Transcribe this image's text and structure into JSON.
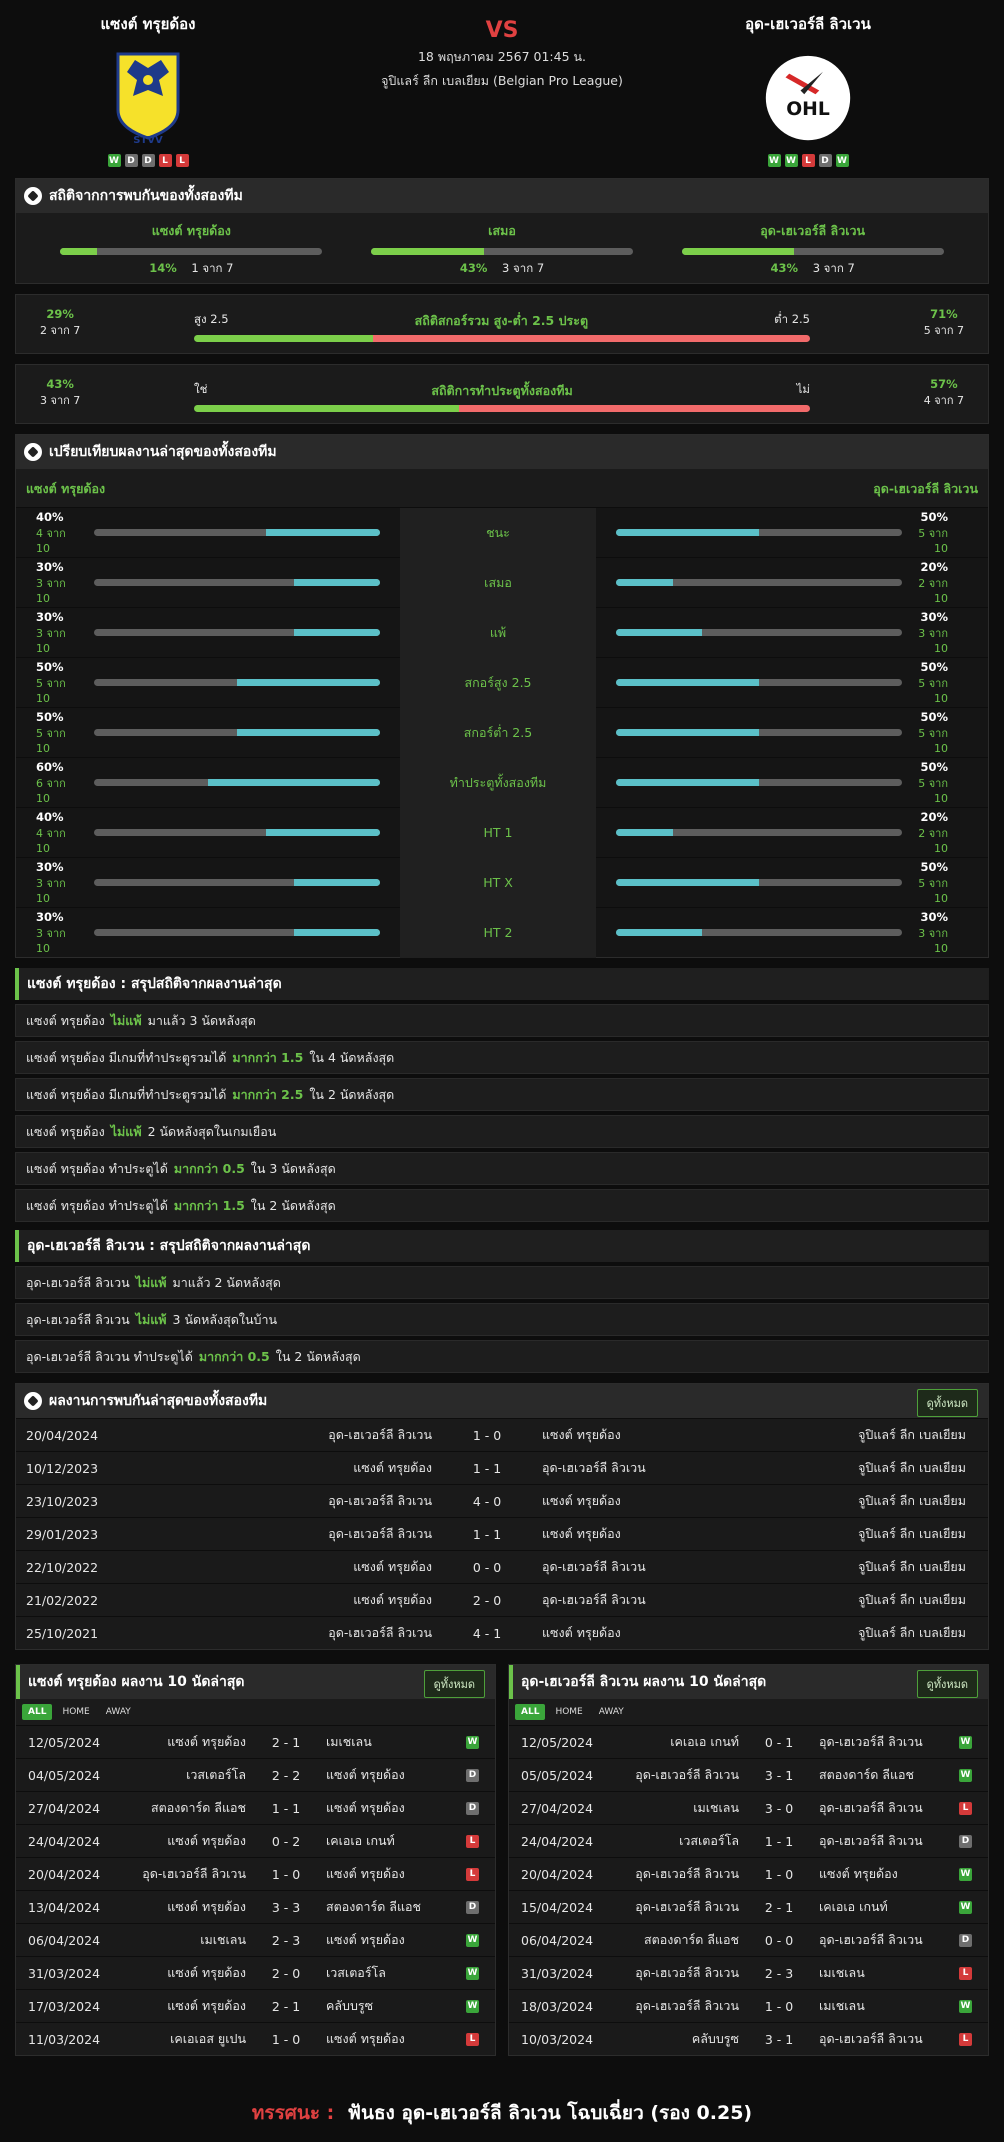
{
  "home": {
    "name": "แซงต์ ทรุยด้อง",
    "form": [
      "W",
      "D",
      "D",
      "L",
      "L"
    ]
  },
  "away": {
    "name": "อุด-เฮเวอร์ลี ลิวเวน",
    "form": [
      "W",
      "W",
      "L",
      "D",
      "W"
    ]
  },
  "match": {
    "vs": "VS",
    "date": "18 พฤษภาคม 2567 01:45 น.",
    "league": "จูปิแลร์ ลีก เบลเยียม (Belgian Pro League)"
  },
  "sections": {
    "h2h_stats": "สถิติจากการพบกันของทั้งสองทีม",
    "compare": "เปรียบเทียบผลงานล่าสุดของทั้งสองทีม",
    "h2h_results": "ผลงานการพบกันล่าสุดของทั้งสองทีม",
    "view_all": "ดูทั้งหมด"
  },
  "h2h_summary": [
    {
      "title": "แซงต์ ทรุยด้อง",
      "pct": "14%",
      "count": "1 จาก 7",
      "fill": 14
    },
    {
      "title": "เสมอ",
      "pct": "43%",
      "count": "3 จาก 7",
      "fill": 43
    },
    {
      "title": "อุด-เฮเวอร์ลี ลิวเวน",
      "pct": "43%",
      "count": "3 จาก 7",
      "fill": 43
    }
  ],
  "over_under": {
    "title": "สถิติสกอร์รวม สูง-ต่ำ 2.5 ประตู",
    "left_label": "สูง 2.5",
    "right_label": "ต่ำ 2.5",
    "left_pct": "29%",
    "left_count": "2 จาก 7",
    "right_pct": "71%",
    "right_count": "5 จาก 7",
    "fill": 29
  },
  "btts": {
    "title": "สถิติการทำประตูทั้งสองทีม",
    "left_label": "ใช่",
    "right_label": "ไม่",
    "left_pct": "43%",
    "left_count": "3 จาก 7",
    "right_pct": "57%",
    "right_count": "4 จาก 7",
    "fill": 43
  },
  "compare_rows": [
    {
      "label": "ชนะ",
      "lp": "40%",
      "lc": "4 จาก 10",
      "lf": 40,
      "rp": "50%",
      "rc": "5 จาก 10",
      "rf": 50
    },
    {
      "label": "เสมอ",
      "lp": "30%",
      "lc": "3 จาก 10",
      "lf": 30,
      "rp": "20%",
      "rc": "2 จาก 10",
      "rf": 20
    },
    {
      "label": "แพ้",
      "lp": "30%",
      "lc": "3 จาก 10",
      "lf": 30,
      "rp": "30%",
      "rc": "3 จาก 10",
      "rf": 30
    },
    {
      "label": "สกอร์สูง 2.5",
      "lp": "50%",
      "lc": "5 จาก 10",
      "lf": 50,
      "rp": "50%",
      "rc": "5 จาก 10",
      "rf": 50
    },
    {
      "label": "สกอร์ต่ำ 2.5",
      "lp": "50%",
      "lc": "5 จาก 10",
      "lf": 50,
      "rp": "50%",
      "rc": "5 จาก 10",
      "rf": 50
    },
    {
      "label": "ทำประตูทั้งสองทีม",
      "lp": "60%",
      "lc": "6 จาก 10",
      "lf": 60,
      "rp": "50%",
      "rc": "5 จาก 10",
      "rf": 50
    },
    {
      "label": "HT 1",
      "lp": "40%",
      "lc": "4 จาก 10",
      "lf": 40,
      "rp": "20%",
      "rc": "2 จาก 10",
      "rf": 20
    },
    {
      "label": "HT X",
      "lp": "30%",
      "lc": "3 จาก 10",
      "lf": 30,
      "rp": "50%",
      "rc": "5 จาก 10",
      "rf": 50
    },
    {
      "label": "HT 2",
      "lp": "30%",
      "lc": "3 จาก 10",
      "lf": 30,
      "rp": "30%",
      "rc": "3 จาก 10",
      "rf": 30
    }
  ],
  "home_summary": {
    "title": "แซงต์ ทรุยด้อง : สรุปสถิติจากผลงานล่าสุด",
    "items": [
      [
        "แซงต์ ทรุยด้อง",
        "ไม่แพ้",
        "มาแล้ว 3 นัดหลังสุด"
      ],
      [
        "แซงต์ ทรุยด้อง  มีเกมที่ทำประตูรวมได้",
        "มากกว่า  1.5",
        "ใน 4 นัดหลังสุด"
      ],
      [
        "แซงต์ ทรุยด้อง  มีเกมที่ทำประตูรวมได้",
        "มากกว่า  2.5",
        "ใน 2 นัดหลังสุด"
      ],
      [
        "แซงต์ ทรุยด้อง",
        "ไม่แพ้",
        "2  นัดหลังสุดในเกมเยือน"
      ],
      [
        "แซงต์ ทรุยด้อง  ทำประตูได้",
        "มากกว่า  0.5",
        "ใน 3 นัดหลังสุด"
      ],
      [
        "แซงต์ ทรุยด้อง  ทำประตูได้",
        "มากกว่า  1.5",
        "ใน 2 นัดหลังสุด"
      ]
    ]
  },
  "away_summary": {
    "title": "อุด-เฮเวอร์ลี ลิวเวน : สรุปสถิติจากผลงานล่าสุด",
    "items": [
      [
        "อุด-เฮเวอร์ลี ลิวเวน",
        "ไม่แพ้",
        "มาแล้ว 2 นัดหลังสุด"
      ],
      [
        "อุด-เฮเวอร์ลี ลิวเวน",
        "ไม่แพ้",
        "3  นัดหลังสุดในบ้าน"
      ],
      [
        "อุด-เฮเวอร์ลี ลิวเวน  ทำประตูได้",
        "มากกว่า  0.5",
        "ใน 2 นัดหลังสุด"
      ]
    ]
  },
  "h2h_results": [
    [
      "20/04/2024",
      "อุด-เฮเวอร์ลี ลิวเวน",
      "1 - 0",
      "แซงต์ ทรุยด้อง",
      "จูปิแลร์ ลีก เบลเยียม"
    ],
    [
      "10/12/2023",
      "แซงต์ ทรุยด้อง",
      "1 - 1",
      "อุด-เฮเวอร์ลี ลิวเวน",
      "จูปิแลร์ ลีก เบลเยียม"
    ],
    [
      "23/10/2023",
      "อุด-เฮเวอร์ลี ลิวเวน",
      "4 - 0",
      "แซงต์ ทรุยด้อง",
      "จูปิแลร์ ลีก เบลเยียม"
    ],
    [
      "29/01/2023",
      "อุด-เฮเวอร์ลี ลิวเวน",
      "1 - 1",
      "แซงต์ ทรุยด้อง",
      "จูปิแลร์ ลีก เบลเยียม"
    ],
    [
      "22/10/2022",
      "แซงต์ ทรุยด้อง",
      "0 - 0",
      "อุด-เฮเวอร์ลี ลิวเวน",
      "จูปิแลร์ ลีก เบลเยียม"
    ],
    [
      "21/02/2022",
      "แซงต์ ทรุยด้อง",
      "2 - 0",
      "อุด-เฮเวอร์ลี ลิวเวน",
      "จูปิแลร์ ลีก เบลเยียม"
    ],
    [
      "25/10/2021",
      "อุด-เฮเวอร์ลี ลิวเวน",
      "4 - 1",
      "แซงต์ ทรุยด้อง",
      "จูปิแลร์ ลีก เบลเยียม"
    ]
  ],
  "tabs": [
    "ALL",
    "HOME",
    "AWAY"
  ],
  "home_last10": {
    "title": "แซงต์ ทรุยด้อง ผลงาน 10 นัดล่าสุด",
    "rows": [
      [
        "12/05/2024",
        "แซงต์ ทรุยด้อง",
        "2 - 1",
        "เมเชเลน",
        "W"
      ],
      [
        "04/05/2024",
        "เวสเตอร์โล",
        "2 - 2",
        "แซงต์ ทรุยด้อง",
        "D"
      ],
      [
        "27/04/2024",
        "สตองดาร์ด ลีแอช",
        "1 - 1",
        "แซงต์ ทรุยด้อง",
        "D"
      ],
      [
        "24/04/2024",
        "แซงต์ ทรุยด้อง",
        "0 - 2",
        "เคเอเอ เกนท์",
        "L"
      ],
      [
        "20/04/2024",
        "อุด-เฮเวอร์ลี ลิวเวน",
        "1 - 0",
        "แซงต์ ทรุยด้อง",
        "L"
      ],
      [
        "13/04/2024",
        "แซงต์ ทรุยด้อง",
        "3 - 3",
        "สตองดาร์ด ลีแอช",
        "D"
      ],
      [
        "06/04/2024",
        "เมเชเลน",
        "2 - 3",
        "แซงต์ ทรุยด้อง",
        "W"
      ],
      [
        "31/03/2024",
        "แซงต์ ทรุยด้อง",
        "2 - 0",
        "เวสเตอร์โล",
        "W"
      ],
      [
        "17/03/2024",
        "แซงต์ ทรุยด้อง",
        "2 - 1",
        "คลับบรูซ",
        "W"
      ],
      [
        "11/03/2024",
        "เคเอเอส ยูเปน",
        "1 - 0",
        "แซงต์ ทรุยด้อง",
        "L"
      ]
    ]
  },
  "away_last10": {
    "title": "อุด-เฮเวอร์ลี ลิวเวน ผลงาน 10 นัดล่าสุด",
    "rows": [
      [
        "12/05/2024",
        "เคเอเอ เกนท์",
        "0 - 1",
        "อุด-เฮเวอร์ลี ลิวเวน",
        "W"
      ],
      [
        "05/05/2024",
        "อุด-เฮเวอร์ลี ลิวเวน",
        "3 - 1",
        "สตองดาร์ด ลีแอช",
        "W"
      ],
      [
        "27/04/2024",
        "เมเชเลน",
        "3 - 0",
        "อุด-เฮเวอร์ลี ลิวเวน",
        "L"
      ],
      [
        "24/04/2024",
        "เวสเตอร์โล",
        "1 - 1",
        "อุด-เฮเวอร์ลี ลิวเวน",
        "D"
      ],
      [
        "20/04/2024",
        "อุด-เฮเวอร์ลี ลิวเวน",
        "1 - 0",
        "แซงต์ ทรุยด้อง",
        "W"
      ],
      [
        "15/04/2024",
        "อุด-เฮเวอร์ลี ลิวเวน",
        "2 - 1",
        "เคเอเอ เกนท์",
        "W"
      ],
      [
        "06/04/2024",
        "สตองดาร์ด ลีแอช",
        "0 - 0",
        "อุด-เฮเวอร์ลี ลิวเวน",
        "D"
      ],
      [
        "31/03/2024",
        "อุด-เฮเวอร์ลี ลิวเวน",
        "2 - 3",
        "เมเชเลน",
        "L"
      ],
      [
        "18/03/2024",
        "อุด-เฮเวอร์ลี ลิวเวน",
        "1 - 0",
        "เมเชเลน",
        "W"
      ],
      [
        "10/03/2024",
        "คลับบรูซ",
        "3 - 1",
        "อุด-เฮเวอร์ลี ลิวเวน",
        "L"
      ]
    ]
  },
  "prediction": {
    "label": "ทรรศนะ :",
    "text": "ฟันธง อุด-เฮเวอร์ลี ลิวเวน โฉบเฉี่ยว (รอง 0.25)"
  },
  "logos": {
    "home_text": "STVV",
    "away_text": "OHL"
  },
  "colors": {
    "green": "#6cc24a",
    "red": "#e04141",
    "teal": "#5bc0c8",
    "coral": "#f26b6b"
  }
}
